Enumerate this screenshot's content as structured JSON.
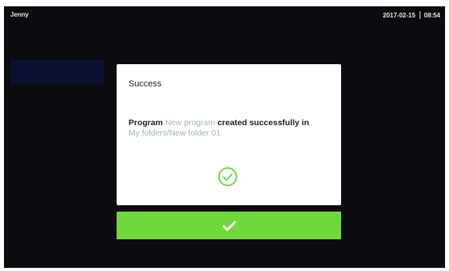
{
  "status_bar": {
    "user": "Jenny",
    "date": "2017-02-15",
    "time": "08:54"
  },
  "dialog": {
    "title": "Success",
    "message": {
      "prefix": "Program",
      "program_name": "New program",
      "middle": "created successfully in",
      "path": "My folders/New folder 01"
    },
    "icon": "check-circle-icon",
    "confirm_icon": "checkmark-icon"
  },
  "colors": {
    "screen_background": "#0b0b10",
    "dialog_background": "#ffffff",
    "accent_green": "#6fd93a",
    "highlight_text": "#9fb3bd"
  }
}
